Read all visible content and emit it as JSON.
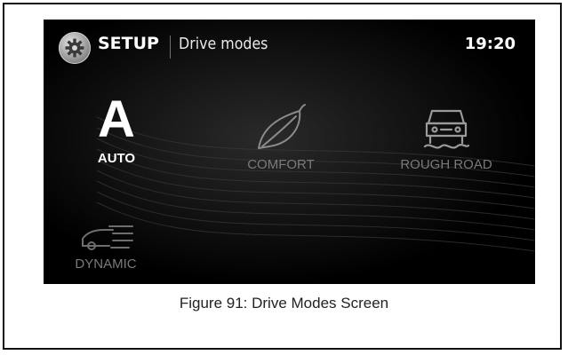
{
  "header": {
    "setup_icon": "gear-icon",
    "title": "SETUP",
    "page": "Drive modes",
    "time": "19:20"
  },
  "modes": [
    {
      "label": "AUTO",
      "glyph": "A",
      "icon": "auto-letter-icon",
      "state": "selected"
    },
    {
      "label": "COMFORT",
      "icon": "leaf-icon",
      "state": "unselected"
    },
    {
      "label": "ROUGH ROAD",
      "icon": "car-offroad-icon",
      "state": "unselected"
    },
    {
      "label": "DYNAMIC",
      "icon": "car-speed-icon",
      "state": "unselected"
    }
  ],
  "caption": "Figure 91: Drive Modes Screen",
  "colors": {
    "screen_background": "#000000",
    "active_text": "#ffffff",
    "inactive_text": "#7a7a7a"
  }
}
